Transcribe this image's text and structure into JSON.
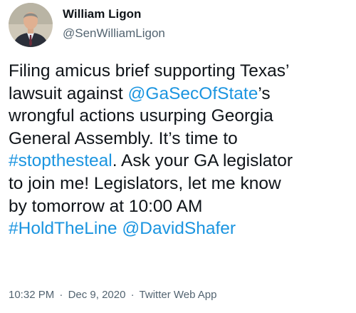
{
  "author": {
    "name": "William Ligon",
    "handle": "@SenWilliamLigon"
  },
  "body": {
    "line1": "Filing amicus brief supporting Texas’",
    "line2_pre": "lawsuit against ",
    "mention_secofstate": "@GaSecOfState",
    "line2_post": "’s",
    "line3": "wrongful actions usurping Georgia",
    "line4": "General Assembly. It’s time to",
    "hashtag_stopthesteal": "#stopthesteal",
    "line5_post": ". Ask your GA legislator",
    "line6": "to join me! Legislators, let me know",
    "line7": "by tomorrow at 10:00 AM",
    "hashtag_holdtheline": "#HoldTheLine",
    "mention_shafer": "@DavidShafer"
  },
  "meta": {
    "time": "10:32 PM",
    "separator": "·",
    "date": "Dec 9, 2020",
    "source": "Twitter Web App"
  },
  "colors": {
    "link": "#1b95e0",
    "text": "#0f1419",
    "secondary": "#536471"
  }
}
